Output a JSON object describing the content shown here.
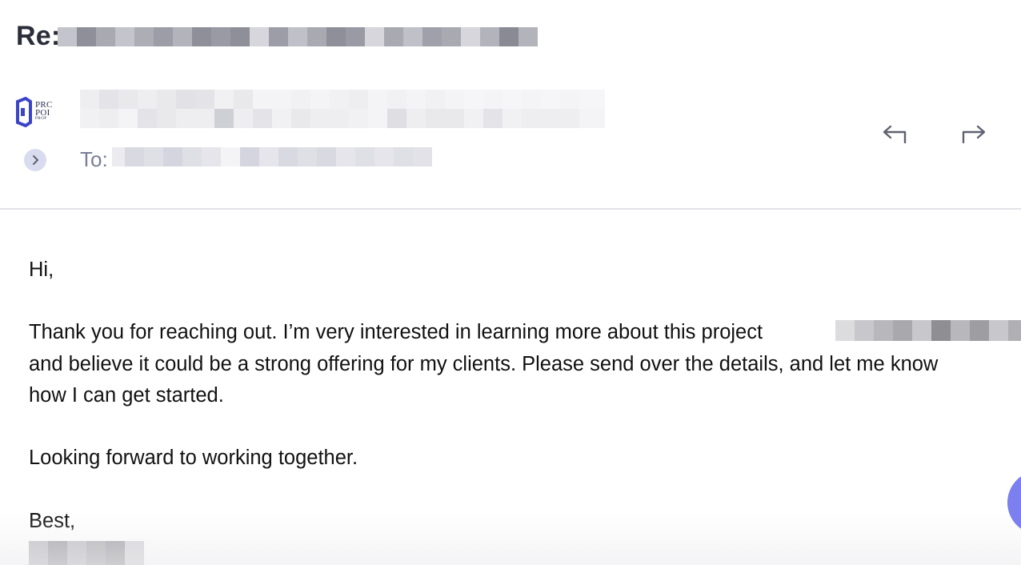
{
  "email": {
    "subject_prefix": "Re:",
    "to_label": "To:",
    "logo": {
      "text_line1": "PRC",
      "text_line2": "POI",
      "text_line3": "PROP",
      "brand_color": "#3a44c8"
    },
    "actions": {
      "reply_icon": "reply-arrow-icon",
      "forward_icon": "forward-arrow-icon",
      "expand_icon": "chevron-right-icon"
    },
    "body": {
      "greeting": "Hi,",
      "paragraph_line1": "Thank you for reaching out. I’m very interested in learning more about this project",
      "paragraph_line2": "and believe it could be a strong offering for my clients. Please send over the details, and let me know",
      "paragraph_line3": "how I can get started.",
      "closing_line": "Looking forward to working together.",
      "signoff": "Best,"
    }
  },
  "colors": {
    "subject_text": "#2b2e3a",
    "to_label": "#7a7e96",
    "expand_button_bg": "#d9dcee",
    "divider": "#e3e4e8",
    "fab": "#7b7ff0",
    "icon_gray": "#5f6170"
  }
}
